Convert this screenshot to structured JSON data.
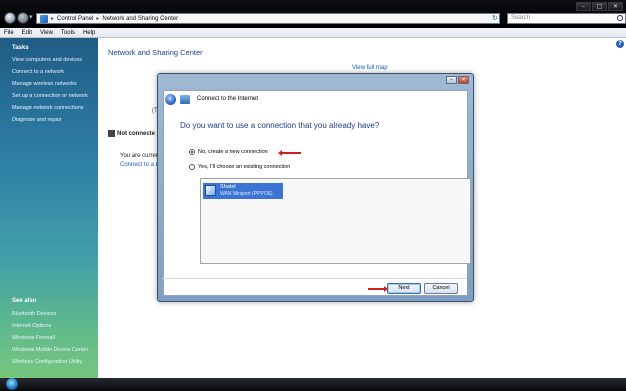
{
  "window": {
    "breadcrumb": [
      "Control Panel",
      "Network and Sharing Center"
    ],
    "search_placeholder": "Search"
  },
  "menu": [
    "File",
    "Edit",
    "View",
    "Tools",
    "Help"
  ],
  "sidebar": {
    "tasks_heading": "Tasks",
    "tasks": [
      "View computers and devices",
      "Connect to a network",
      "Manage wireless networks",
      "Set up a connection or network",
      "Manage network connections",
      "Diagnose and repair"
    ],
    "see_also_heading": "See also",
    "see_also": [
      "Bluetooth Devices",
      "Internet Options",
      "Windows Firewall",
      "Windows Mobile Device Center",
      "Wireless Configuration Utility"
    ]
  },
  "main": {
    "title": "Network and Sharing Center",
    "view_full_map": "View full map",
    "status_fragment": "(T",
    "not_connected": "Not connecte",
    "are_current": "You are curren",
    "connect_to": "Connect to a n"
  },
  "dialog": {
    "title": "Connect to the Internet",
    "question": "Do you want to use a connection that you already have?",
    "option_new": "No, create a new connection",
    "option_existing": "Yes, I'll choose an existing connection",
    "connection_name": "Shatel",
    "connection_type": "WAN Miniport (PPPOE)",
    "next_label": "Next",
    "cancel_label": "Cancel",
    "selected_option": "option_new"
  }
}
